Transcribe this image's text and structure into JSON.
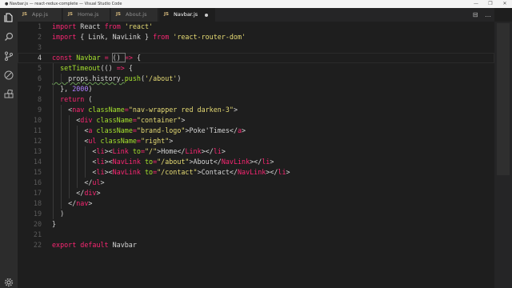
{
  "window": {
    "title": "● Navbar.js — react-redux-complete — Visual Studio Code",
    "controls": [
      "—",
      "❐",
      "✕"
    ]
  },
  "activity_bar": {
    "icons": [
      "files-icon",
      "search-icon",
      "source-control-icon",
      "debug-icon",
      "extensions-icon",
      "settings-gear-icon"
    ]
  },
  "tabs": [
    {
      "label": "App.js",
      "badge": "JS",
      "active": false
    },
    {
      "label": "Home.js",
      "badge": "JS",
      "active": false
    },
    {
      "label": "About.js",
      "badge": "JS",
      "active": false
    },
    {
      "label": "Navbar.js",
      "badge": "JS",
      "active": true,
      "dirty": true
    }
  ],
  "tab_actions": [
    "⊟",
    "…"
  ],
  "editor": {
    "file": "Navbar.js",
    "current_line": 4,
    "lines": [
      {
        "n": 1,
        "tokens": [
          [
            "k",
            "import "
          ],
          [
            "p",
            "React "
          ],
          [
            "k",
            "from "
          ],
          [
            "s",
            "'react'"
          ]
        ]
      },
      {
        "n": 2,
        "tokens": [
          [
            "k",
            "import "
          ],
          [
            "p",
            "{ Link, NavLink } "
          ],
          [
            "k",
            "from "
          ],
          [
            "s",
            "'react-router-dom'"
          ]
        ]
      },
      {
        "n": 3,
        "tokens": []
      },
      {
        "n": 4,
        "tokens": [
          [
            "k",
            "const "
          ],
          [
            "f",
            "Navbar "
          ],
          [
            "k",
            "= "
          ],
          [
            "p",
            "() "
          ],
          [
            "k",
            "=> "
          ],
          [
            "p",
            "{"
          ]
        ]
      },
      {
        "n": 5,
        "tokens": [
          [
            "p",
            "  "
          ],
          [
            "f",
            "setTimeout"
          ],
          [
            "p",
            "(() "
          ],
          [
            "k",
            "=> "
          ],
          [
            "p",
            "{"
          ]
        ]
      },
      {
        "n": 6,
        "tokens": [
          [
            "p",
            "    props.history."
          ],
          [
            "f",
            "push"
          ],
          [
            "p",
            "("
          ],
          [
            "s",
            "'/about'"
          ],
          [
            "p",
            ")"
          ]
        ]
      },
      {
        "n": 7,
        "tokens": [
          [
            "p",
            "  }, "
          ],
          [
            "n",
            "2000"
          ],
          [
            "p",
            ")"
          ]
        ]
      },
      {
        "n": 8,
        "tokens": [
          [
            "p",
            "  "
          ],
          [
            "k",
            "return "
          ],
          [
            "p",
            "("
          ]
        ]
      },
      {
        "n": 9,
        "tokens": [
          [
            "p",
            "    <"
          ],
          [
            "t",
            "nav "
          ],
          [
            "a",
            "className"
          ],
          [
            "k",
            "="
          ],
          [
            "s",
            "\"nav-wrapper red darken-3\""
          ],
          [
            "p",
            ">"
          ]
        ]
      },
      {
        "n": 10,
        "tokens": [
          [
            "p",
            "      <"
          ],
          [
            "t",
            "div "
          ],
          [
            "a",
            "className"
          ],
          [
            "k",
            "="
          ],
          [
            "s",
            "\"container\""
          ],
          [
            "p",
            ">"
          ]
        ]
      },
      {
        "n": 11,
        "tokens": [
          [
            "p",
            "        <"
          ],
          [
            "t",
            "a "
          ],
          [
            "a",
            "className"
          ],
          [
            "k",
            "="
          ],
          [
            "s",
            "\"brand-logo\""
          ],
          [
            "p",
            ">Poke'Times</"
          ],
          [
            "t",
            "a"
          ],
          [
            "p",
            ">"
          ]
        ]
      },
      {
        "n": 12,
        "tokens": [
          [
            "p",
            "        <"
          ],
          [
            "t",
            "ul "
          ],
          [
            "a",
            "className"
          ],
          [
            "k",
            "="
          ],
          [
            "s",
            "\"right\""
          ],
          [
            "p",
            ">"
          ]
        ]
      },
      {
        "n": 13,
        "tokens": [
          [
            "p",
            "          <"
          ],
          [
            "t",
            "li"
          ],
          [
            "p",
            "><"
          ],
          [
            "t",
            "Link "
          ],
          [
            "a",
            "to"
          ],
          [
            "k",
            "="
          ],
          [
            "s",
            "\"/\""
          ],
          [
            "p",
            ">Home</"
          ],
          [
            "t",
            "Link"
          ],
          [
            "p",
            "></"
          ],
          [
            "t",
            "li"
          ],
          [
            "p",
            ">"
          ]
        ]
      },
      {
        "n": 14,
        "tokens": [
          [
            "p",
            "          <"
          ],
          [
            "t",
            "li"
          ],
          [
            "p",
            "><"
          ],
          [
            "t",
            "NavLink "
          ],
          [
            "a",
            "to"
          ],
          [
            "k",
            "="
          ],
          [
            "s",
            "\"/about\""
          ],
          [
            "p",
            ">About</"
          ],
          [
            "t",
            "NavLink"
          ],
          [
            "p",
            "></"
          ],
          [
            "t",
            "li"
          ],
          [
            "p",
            ">"
          ]
        ]
      },
      {
        "n": 15,
        "tokens": [
          [
            "p",
            "          <"
          ],
          [
            "t",
            "li"
          ],
          [
            "p",
            "><"
          ],
          [
            "t",
            "NavLink "
          ],
          [
            "a",
            "to"
          ],
          [
            "k",
            "="
          ],
          [
            "s",
            "\"/contact\""
          ],
          [
            "p",
            ">Contact</"
          ],
          [
            "t",
            "NavLink"
          ],
          [
            "p",
            "></"
          ],
          [
            "t",
            "li"
          ],
          [
            "p",
            ">"
          ]
        ]
      },
      {
        "n": 16,
        "tokens": [
          [
            "p",
            "        </"
          ],
          [
            "t",
            "ul"
          ],
          [
            "p",
            ">"
          ]
        ]
      },
      {
        "n": 17,
        "tokens": [
          [
            "p",
            "      </"
          ],
          [
            "t",
            "div"
          ],
          [
            "p",
            ">"
          ]
        ]
      },
      {
        "n": 18,
        "tokens": [
          [
            "p",
            "    </"
          ],
          [
            "t",
            "nav"
          ],
          [
            "p",
            ">"
          ]
        ]
      },
      {
        "n": 19,
        "tokens": [
          [
            "p",
            "  )"
          ]
        ]
      },
      {
        "n": 20,
        "tokens": [
          [
            "p",
            "}"
          ]
        ]
      },
      {
        "n": 21,
        "tokens": []
      },
      {
        "n": 22,
        "tokens": [
          [
            "k",
            "export "
          ],
          [
            "k",
            "default "
          ],
          [
            "p",
            "Navbar"
          ]
        ]
      }
    ]
  },
  "colors": {
    "keyword": "#f92672",
    "string": "#e6db74",
    "function": "#a6e22e",
    "number": "#ae81ff",
    "background": "#1e1e1e",
    "activity_bar": "#2c2c2c"
  }
}
